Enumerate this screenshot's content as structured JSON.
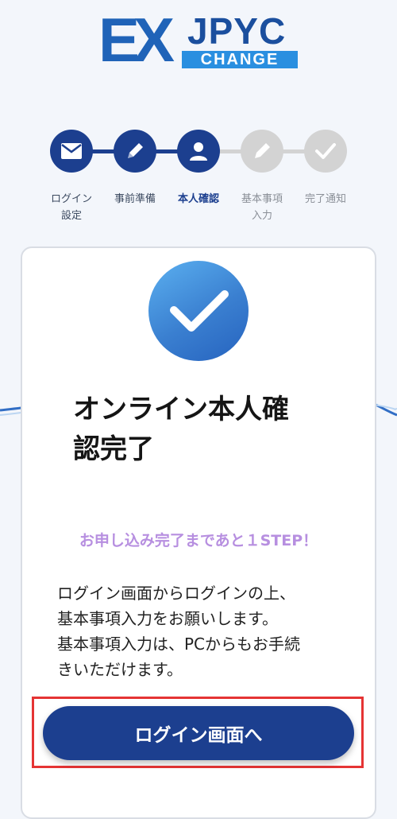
{
  "logo": {
    "ex": "EX",
    "jpyc": "JPYC",
    "change": "CHANGE"
  },
  "steps": [
    {
      "label_line1": "ログイン",
      "label_line2": "設定",
      "icon": "mail-icon",
      "state": "done"
    },
    {
      "label_line1": "事前準備",
      "label_line2": "",
      "icon": "pencil-icon",
      "state": "done"
    },
    {
      "label_line1": "本人確認",
      "label_line2": "",
      "icon": "person-icon",
      "state": "current"
    },
    {
      "label_line1": "基本事項",
      "label_line2": "入力",
      "icon": "pencil-icon",
      "state": "todo"
    },
    {
      "label_line1": "完了通知",
      "label_line2": "",
      "icon": "check-icon",
      "state": "todo"
    }
  ],
  "card": {
    "icon": "check-icon",
    "title_line1": "オンライン本人確",
    "title_line2": "認完了",
    "subtitle": "お申し込み完了まであと１STEP！",
    "body_lines": [
      "ログイン画面からログインの上、",
      "基本事項入力をお願いします。",
      "基本事項入力は、PCからもお手続",
      "きいただけます。"
    ],
    "button_label": "ログイン画面へ"
  },
  "colors": {
    "primary": "#1c3f8f",
    "inactive": "#d3d3d3",
    "subtitle": "#b78fe0",
    "highlight": "#e53434",
    "check_gradient_start": "#5bb0f0",
    "check_gradient_end": "#2663bf"
  }
}
